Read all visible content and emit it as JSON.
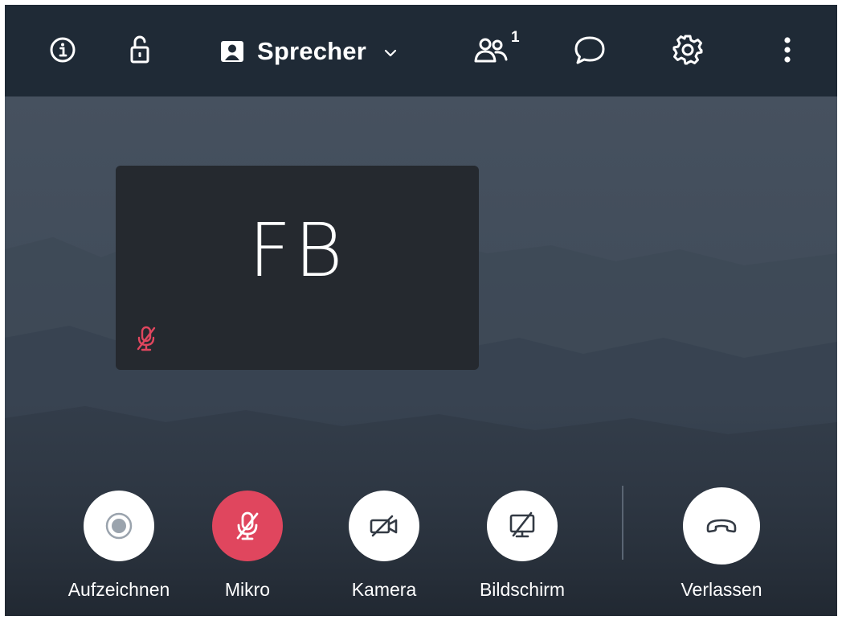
{
  "topbar": {
    "presenter_label": "Sprecher",
    "participants_count": "1",
    "icons": {
      "info": "info-icon",
      "lock": "unlock-icon",
      "presenter": "user-card-icon",
      "chevron": "chevron-down-icon",
      "participants": "users-icon",
      "chat": "chat-icon",
      "settings": "gear-icon",
      "more": "more-vertical-icon"
    }
  },
  "tile": {
    "initials": "FB",
    "mic_state_icon": "mic-off-icon"
  },
  "controls": [
    {
      "label": "Aufzeichnen",
      "icon": "record-icon"
    },
    {
      "label": "Mikro",
      "icon": "mic-off-icon",
      "state": "muted"
    },
    {
      "label": "Kamera",
      "icon": "camera-off-icon"
    },
    {
      "label": "Bildschirm",
      "icon": "screen-share-off-icon"
    },
    {
      "label": "Verlassen",
      "icon": "hangup-icon"
    }
  ],
  "colors": {
    "topbar_bg": "#1f2a36",
    "tile_bg": "#25292f",
    "muted_red": "#e0465e",
    "icon_dark": "#333a44"
  }
}
